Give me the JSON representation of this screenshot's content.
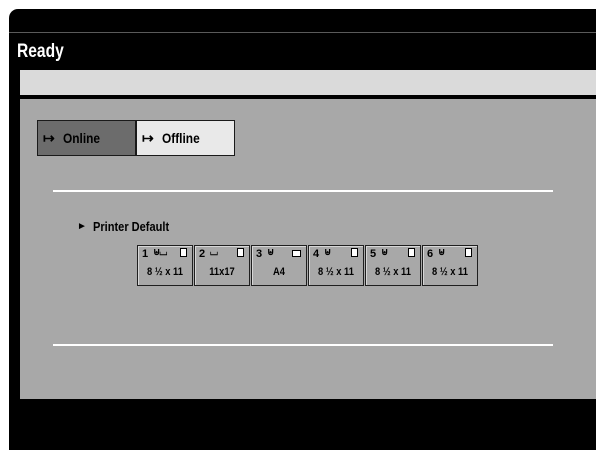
{
  "status": "Ready",
  "modes": {
    "online_label": "Online",
    "offline_label": "Offline",
    "online_icon": "arrow-bar-right-icon",
    "offline_icon": "arrow-bar-right-open-icon",
    "selected": "Online"
  },
  "printer_default_label": "Printer Default",
  "trays": [
    {
      "number": "1",
      "bin": "⊎⌴",
      "size": "8 ½  x 11"
    },
    {
      "number": "2",
      "bin": "⌴",
      "size": "11x17"
    },
    {
      "number": "3",
      "bin": "⊎",
      "size": "A4"
    },
    {
      "number": "4",
      "bin": "⊎",
      "size": "8 ½  x 11"
    },
    {
      "number": "5",
      "bin": "⊎",
      "size": "8 ½  x 11"
    },
    {
      "number": "6",
      "bin": "⊎",
      "size": "8 ½  x 11"
    }
  ],
  "colors": {
    "screen_bg": "#000000",
    "panel_bg": "#a8a8a8",
    "selected_button": "#6c6c6c",
    "unselected_button": "#e9e9e9"
  }
}
